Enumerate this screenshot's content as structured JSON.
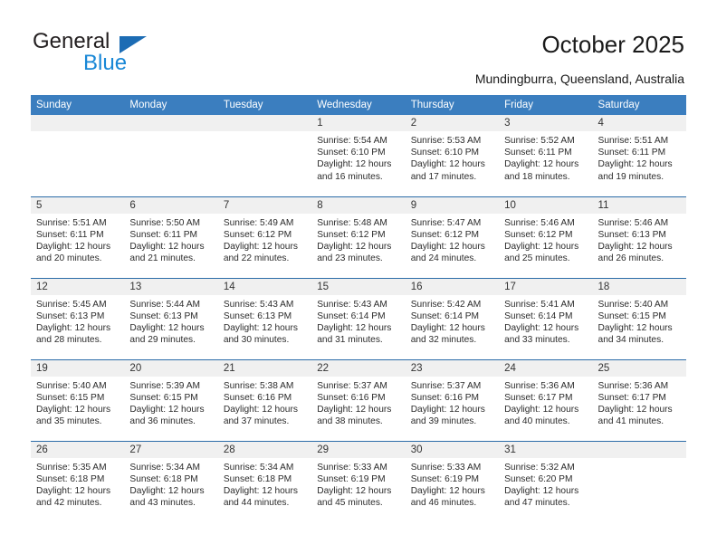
{
  "brand": {
    "name_top": "General",
    "name_bottom": "Blue",
    "accent_color": "#1887d6",
    "triangle_color": "#1c6cb4"
  },
  "header": {
    "title": "October 2025",
    "location": "Mundingburra, Queensland, Australia"
  },
  "calendar": {
    "header_bg": "#3b7ebf",
    "row_divider_color": "#2b6ca8",
    "daynum_bg": "#f0f0f0",
    "weekday_headers": [
      "Sunday",
      "Monday",
      "Tuesday",
      "Wednesday",
      "Thursday",
      "Friday",
      "Saturday"
    ],
    "weeks": [
      [
        {
          "day": "",
          "blank": true
        },
        {
          "day": "",
          "blank": true
        },
        {
          "day": "",
          "blank": true
        },
        {
          "day": "1",
          "sunrise": "Sunrise: 5:54 AM",
          "sunset": "Sunset: 6:10 PM",
          "daylight": "Daylight: 12 hours and 16 minutes."
        },
        {
          "day": "2",
          "sunrise": "Sunrise: 5:53 AM",
          "sunset": "Sunset: 6:10 PM",
          "daylight": "Daylight: 12 hours and 17 minutes."
        },
        {
          "day": "3",
          "sunrise": "Sunrise: 5:52 AM",
          "sunset": "Sunset: 6:11 PM",
          "daylight": "Daylight: 12 hours and 18 minutes."
        },
        {
          "day": "4",
          "sunrise": "Sunrise: 5:51 AM",
          "sunset": "Sunset: 6:11 PM",
          "daylight": "Daylight: 12 hours and 19 minutes."
        }
      ],
      [
        {
          "day": "5",
          "sunrise": "Sunrise: 5:51 AM",
          "sunset": "Sunset: 6:11 PM",
          "daylight": "Daylight: 12 hours and 20 minutes."
        },
        {
          "day": "6",
          "sunrise": "Sunrise: 5:50 AM",
          "sunset": "Sunset: 6:11 PM",
          "daylight": "Daylight: 12 hours and 21 minutes."
        },
        {
          "day": "7",
          "sunrise": "Sunrise: 5:49 AM",
          "sunset": "Sunset: 6:12 PM",
          "daylight": "Daylight: 12 hours and 22 minutes."
        },
        {
          "day": "8",
          "sunrise": "Sunrise: 5:48 AM",
          "sunset": "Sunset: 6:12 PM",
          "daylight": "Daylight: 12 hours and 23 minutes."
        },
        {
          "day": "9",
          "sunrise": "Sunrise: 5:47 AM",
          "sunset": "Sunset: 6:12 PM",
          "daylight": "Daylight: 12 hours and 24 minutes."
        },
        {
          "day": "10",
          "sunrise": "Sunrise: 5:46 AM",
          "sunset": "Sunset: 6:12 PM",
          "daylight": "Daylight: 12 hours and 25 minutes."
        },
        {
          "day": "11",
          "sunrise": "Sunrise: 5:46 AM",
          "sunset": "Sunset: 6:13 PM",
          "daylight": "Daylight: 12 hours and 26 minutes."
        }
      ],
      [
        {
          "day": "12",
          "sunrise": "Sunrise: 5:45 AM",
          "sunset": "Sunset: 6:13 PM",
          "daylight": "Daylight: 12 hours and 28 minutes."
        },
        {
          "day": "13",
          "sunrise": "Sunrise: 5:44 AM",
          "sunset": "Sunset: 6:13 PM",
          "daylight": "Daylight: 12 hours and 29 minutes."
        },
        {
          "day": "14",
          "sunrise": "Sunrise: 5:43 AM",
          "sunset": "Sunset: 6:13 PM",
          "daylight": "Daylight: 12 hours and 30 minutes."
        },
        {
          "day": "15",
          "sunrise": "Sunrise: 5:43 AM",
          "sunset": "Sunset: 6:14 PM",
          "daylight": "Daylight: 12 hours and 31 minutes."
        },
        {
          "day": "16",
          "sunrise": "Sunrise: 5:42 AM",
          "sunset": "Sunset: 6:14 PM",
          "daylight": "Daylight: 12 hours and 32 minutes."
        },
        {
          "day": "17",
          "sunrise": "Sunrise: 5:41 AM",
          "sunset": "Sunset: 6:14 PM",
          "daylight": "Daylight: 12 hours and 33 minutes."
        },
        {
          "day": "18",
          "sunrise": "Sunrise: 5:40 AM",
          "sunset": "Sunset: 6:15 PM",
          "daylight": "Daylight: 12 hours and 34 minutes."
        }
      ],
      [
        {
          "day": "19",
          "sunrise": "Sunrise: 5:40 AM",
          "sunset": "Sunset: 6:15 PM",
          "daylight": "Daylight: 12 hours and 35 minutes."
        },
        {
          "day": "20",
          "sunrise": "Sunrise: 5:39 AM",
          "sunset": "Sunset: 6:15 PM",
          "daylight": "Daylight: 12 hours and 36 minutes."
        },
        {
          "day": "21",
          "sunrise": "Sunrise: 5:38 AM",
          "sunset": "Sunset: 6:16 PM",
          "daylight": "Daylight: 12 hours and 37 minutes."
        },
        {
          "day": "22",
          "sunrise": "Sunrise: 5:37 AM",
          "sunset": "Sunset: 6:16 PM",
          "daylight": "Daylight: 12 hours and 38 minutes."
        },
        {
          "day": "23",
          "sunrise": "Sunrise: 5:37 AM",
          "sunset": "Sunset: 6:16 PM",
          "daylight": "Daylight: 12 hours and 39 minutes."
        },
        {
          "day": "24",
          "sunrise": "Sunrise: 5:36 AM",
          "sunset": "Sunset: 6:17 PM",
          "daylight": "Daylight: 12 hours and 40 minutes."
        },
        {
          "day": "25",
          "sunrise": "Sunrise: 5:36 AM",
          "sunset": "Sunset: 6:17 PM",
          "daylight": "Daylight: 12 hours and 41 minutes."
        }
      ],
      [
        {
          "day": "26",
          "sunrise": "Sunrise: 5:35 AM",
          "sunset": "Sunset: 6:18 PM",
          "daylight": "Daylight: 12 hours and 42 minutes."
        },
        {
          "day": "27",
          "sunrise": "Sunrise: 5:34 AM",
          "sunset": "Sunset: 6:18 PM",
          "daylight": "Daylight: 12 hours and 43 minutes."
        },
        {
          "day": "28",
          "sunrise": "Sunrise: 5:34 AM",
          "sunset": "Sunset: 6:18 PM",
          "daylight": "Daylight: 12 hours and 44 minutes."
        },
        {
          "day": "29",
          "sunrise": "Sunrise: 5:33 AM",
          "sunset": "Sunset: 6:19 PM",
          "daylight": "Daylight: 12 hours and 45 minutes."
        },
        {
          "day": "30",
          "sunrise": "Sunrise: 5:33 AM",
          "sunset": "Sunset: 6:19 PM",
          "daylight": "Daylight: 12 hours and 46 minutes."
        },
        {
          "day": "31",
          "sunrise": "Sunrise: 5:32 AM",
          "sunset": "Sunset: 6:20 PM",
          "daylight": "Daylight: 12 hours and 47 minutes."
        },
        {
          "day": "",
          "blank": true
        }
      ]
    ]
  }
}
